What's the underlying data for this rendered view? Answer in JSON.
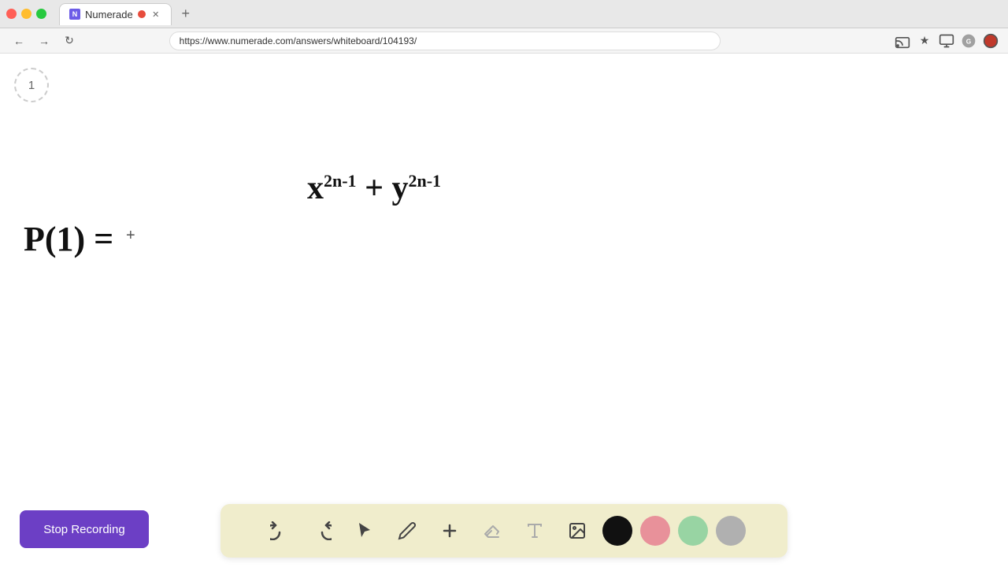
{
  "browser": {
    "tab_title": "Numerade",
    "url": "https://www.numerade.com/answers/whiteboard/104193/",
    "new_tab_label": "+"
  },
  "toolbar": {
    "undo_label": "↺",
    "redo_label": "↻",
    "stop_recording_label": "Stop Recording"
  },
  "whiteboard": {
    "page_number": "1",
    "math_expression": "x²ⁿ⁻¹ + y²ⁿ⁻¹",
    "p1_expression": "P(1) ="
  },
  "colors": {
    "black": "#111111",
    "pink": "#e8919a",
    "green": "#98d4a3",
    "gray": "#b0b0b0",
    "purple": "#6c3fc5"
  }
}
